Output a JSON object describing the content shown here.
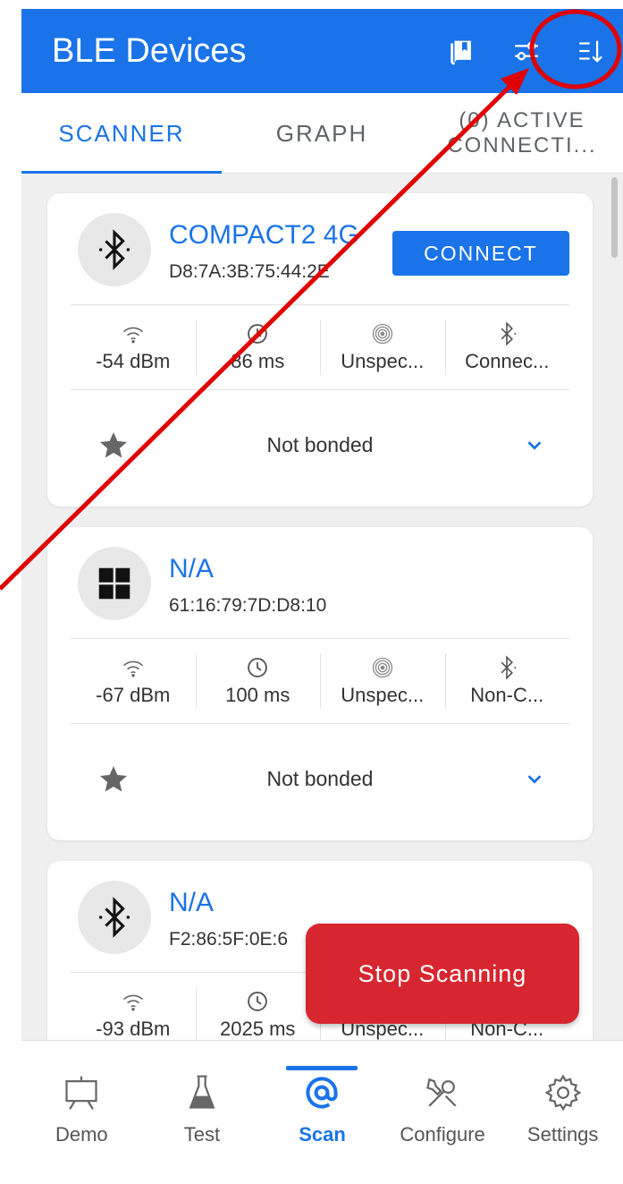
{
  "appbar": {
    "title": "BLE Devices",
    "icons": [
      "book-icon",
      "tune-sliders-icon",
      "sort-icon"
    ],
    "color": "#1a73e8"
  },
  "tabs": [
    {
      "label": "SCANNER",
      "active": true
    },
    {
      "label": "GRAPH",
      "active": false
    },
    {
      "label": "(0) ACTIVE CONNECTI...",
      "active": false
    }
  ],
  "devices": [
    {
      "name": "COMPACT2 4G",
      "address": "D8:7A:3B:75:44:2E",
      "icon": "bluetooth-icon",
      "connect_label": "CONNECT",
      "rssi": "-54 dBm",
      "interval": "86 ms",
      "tx": "Unspec...",
      "connectable": "Connec...",
      "bond": "Not bonded"
    },
    {
      "name": "N/A",
      "address": "61:16:79:7D:D8:10",
      "icon": "windows-icon",
      "rssi": "-67 dBm",
      "interval": "100 ms",
      "tx": "Unspec...",
      "connectable": "Non-C...",
      "bond": "Not bonded"
    },
    {
      "name": "N/A",
      "address": "F2:86:5F:0E:6",
      "icon": "bluetooth-icon",
      "rssi": "-93 dBm",
      "interval": "2025 ms",
      "tx": "Unspec...",
      "connectable": "Non-C..."
    }
  ],
  "fab": {
    "label": "Stop Scanning",
    "color": "#d7262f"
  },
  "bottom_nav": [
    {
      "label": "Demo",
      "icon": "easel-icon"
    },
    {
      "label": "Test",
      "icon": "flask-icon"
    },
    {
      "label": "Scan",
      "icon": "scan-icon",
      "active": true
    },
    {
      "label": "Configure",
      "icon": "tools-icon"
    },
    {
      "label": "Settings",
      "icon": "gear-icon"
    }
  ],
  "annotation_color": "#e00000"
}
